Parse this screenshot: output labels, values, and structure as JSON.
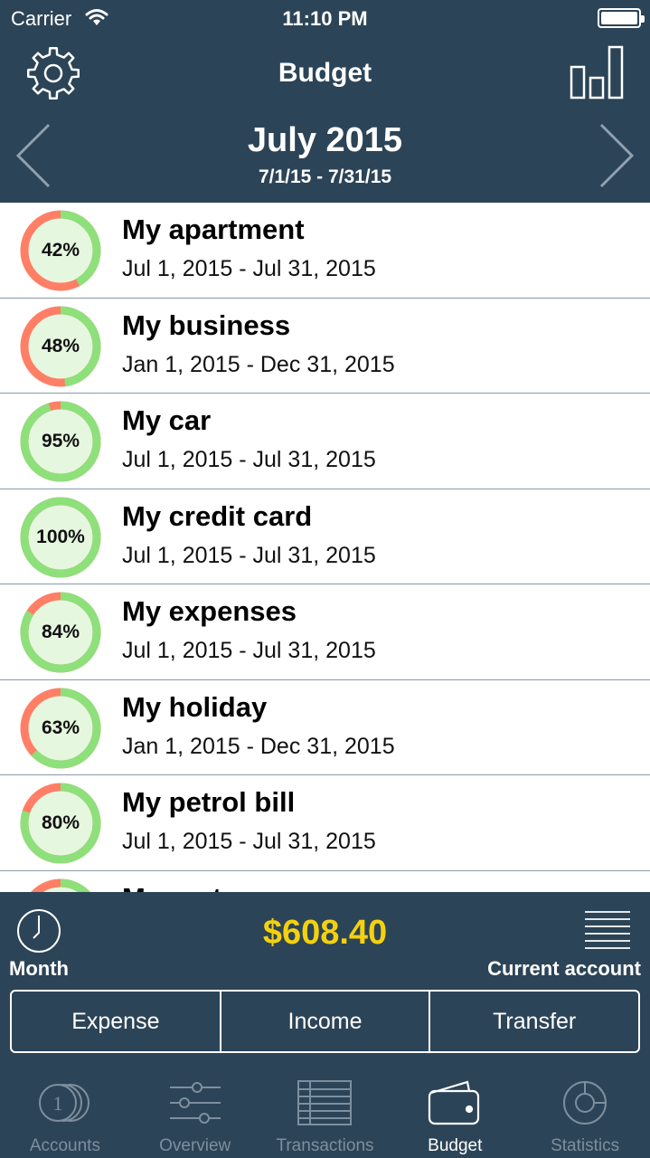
{
  "status_bar": {
    "carrier": "Carrier",
    "time": "11:10 PM"
  },
  "header": {
    "title": "Budget",
    "month": "July 2015",
    "range": "7/1/15 - 7/31/15",
    "icons": {
      "settings": "gear-icon",
      "stats": "bar-chart-icon",
      "prev": "chevron-left-icon",
      "next": "chevron-right-icon"
    }
  },
  "colors": {
    "header_bg": "#2c4457",
    "progress_green": "#8ee07a",
    "progress_red": "#ff7f66",
    "total_yellow": "#f4d10f"
  },
  "budgets": [
    {
      "name": "My apartment",
      "dates": "Jul 1, 2015 - Jul 31, 2015",
      "percent_label": "42%",
      "percent": 42
    },
    {
      "name": "My business",
      "dates": "Jan 1, 2015 - Dec 31, 2015",
      "percent_label": "48%",
      "percent": 48
    },
    {
      "name": "My car",
      "dates": "Jul 1, 2015 - Jul 31, 2015",
      "percent_label": "95%",
      "percent": 95
    },
    {
      "name": "My credit card",
      "dates": "Jul 1, 2015 - Jul 31, 2015",
      "percent_label": "100%",
      "percent": 100
    },
    {
      "name": "My expenses",
      "dates": "Jul 1, 2015 - Jul 31, 2015",
      "percent_label": "84%",
      "percent": 84
    },
    {
      "name": "My holiday",
      "dates": "Jan 1, 2015 - Dec 31, 2015",
      "percent_label": "63%",
      "percent": 63
    },
    {
      "name": "My petrol bill",
      "dates": "Jul 1, 2015 - Jul 31, 2015",
      "percent_label": "80%",
      "percent": 80
    },
    {
      "name": "My rent",
      "dates": "",
      "percent_label": "",
      "percent": 75
    }
  ],
  "summary": {
    "period": "Month",
    "total": "$608.40",
    "account": "Current account",
    "buttons": {
      "expense": "Expense",
      "income": "Income",
      "transfer": "Transfer"
    }
  },
  "tabs": {
    "accounts": "Accounts",
    "overview": "Overview",
    "transactions": "Transactions",
    "budget": "Budget",
    "statistics": "Statistics",
    "active": "budget"
  }
}
